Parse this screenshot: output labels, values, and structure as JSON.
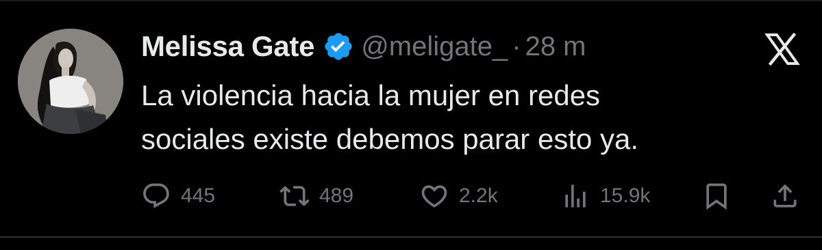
{
  "author": {
    "display_name": "Melissa Gate",
    "handle": "@meligate_",
    "separator": "·",
    "timestamp": "28 m",
    "verified": true
  },
  "tweet": {
    "text_lines": [
      "La violencia hacia la mujer en redes",
      "sociales existe debemos parar esto ya."
    ]
  },
  "actions": {
    "replies": "445",
    "retweets": "489",
    "likes": "2.2k",
    "views": "15.9k"
  },
  "icons": {
    "brand": "x-logo-icon",
    "verified": "verified-badge-icon",
    "reply": "reply-icon",
    "retweet": "retweet-icon",
    "like": "heart-icon",
    "views": "views-icon",
    "bookmark": "bookmark-icon",
    "share": "share-icon"
  },
  "colors": {
    "background": "#000000",
    "primary_text": "#e7e9ea",
    "secondary_text": "#71767b",
    "verified_blue": "#1d9bf0"
  }
}
